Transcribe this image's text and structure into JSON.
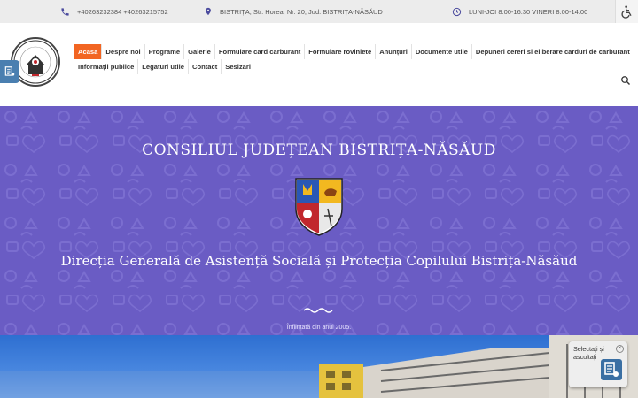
{
  "topbar": {
    "phone": "+40263232384 +40263215752",
    "address": "BISTRIȚA, Str. Horea, Nr. 20, Jud. BISTRIȚA-NĂSĂUD",
    "hours": "LUNI-JOI 8.00-16.30 VINERI 8.00-14.00"
  },
  "nav": {
    "row1": [
      {
        "label": "Acasa",
        "active": true
      },
      {
        "label": "Despre noi"
      },
      {
        "label": "Programe"
      },
      {
        "label": "Galerie"
      },
      {
        "label": "Formulare card carburant"
      },
      {
        "label": "Formulare roviniete"
      },
      {
        "label": "Anunțuri"
      },
      {
        "label": "Documente utile"
      },
      {
        "label": "Depuneri cereri si eliberare carduri de carburant"
      }
    ],
    "row2": [
      {
        "label": "Informații publice"
      },
      {
        "label": "Legaturi utile"
      },
      {
        "label": "Contact"
      },
      {
        "label": "Sesizari"
      }
    ]
  },
  "hero": {
    "council": "CONSILIUL JUDEȚEAN BISTRIȚA-NĂSĂUD",
    "directorate": "Direcția Generală de Asistență Socială și Protecția Copilului Bistrița-Năsăud",
    "founded": "Înființată din anul 2005."
  },
  "widget": {
    "text": "Selectați și ascultați",
    "close": "×"
  },
  "colors": {
    "accent": "#f26522",
    "hero_bg": "#6a5cc4",
    "topbar_bg": "#ececec"
  },
  "icons": [
    "phone-icon",
    "location-pin-icon",
    "clock-icon",
    "accessibility-icon",
    "search-icon",
    "reader-icon",
    "close-icon"
  ]
}
